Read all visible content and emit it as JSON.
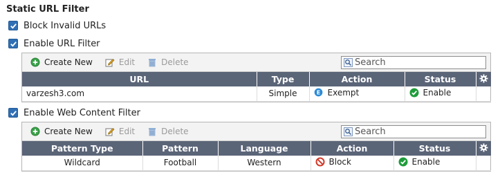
{
  "section_title": "Static URL Filter",
  "checkboxes": {
    "block_invalid": {
      "label": "Block Invalid URLs",
      "checked": true
    },
    "enable_url_filter": {
      "label": "Enable URL Filter",
      "checked": true
    },
    "enable_web_content": {
      "label": "Enable Web Content Filter",
      "checked": true
    }
  },
  "url_filter": {
    "toolbar": {
      "create_new": "Create New",
      "edit": "Edit",
      "delete": "Delete",
      "search_placeholder": "Search"
    },
    "columns": [
      "URL",
      "Type",
      "Action",
      "Status"
    ],
    "rows": [
      {
        "url": "varzesh3.com",
        "type": "Simple",
        "action": "Exempt",
        "status": "Enable"
      }
    ]
  },
  "web_content_filter": {
    "toolbar": {
      "create_new": "Create New",
      "edit": "Edit",
      "delete": "Delete",
      "search_placeholder": "Search"
    },
    "columns": [
      "Pattern Type",
      "Pattern",
      "Language",
      "Action",
      "Status"
    ],
    "rows": [
      {
        "pattern_type": "Wildcard",
        "pattern": "Football",
        "language": "Western",
        "action": "Block",
        "status": "Enable"
      }
    ]
  },
  "colors": {
    "header_bg": "#5b6578",
    "checkbox": "#2f6fb5",
    "enable_green": "#1e9c3a",
    "block_red": "#d23a2a",
    "exempt_blue": "#2b8ad6"
  },
  "icons": {
    "create_new": "plus-circle-icon",
    "edit": "pencil-icon",
    "delete": "trash-icon",
    "search": "search-icon",
    "settings": "gear-icon",
    "exempt": "exempt-badge-icon",
    "enable": "check-circle-icon",
    "block": "block-icon"
  }
}
